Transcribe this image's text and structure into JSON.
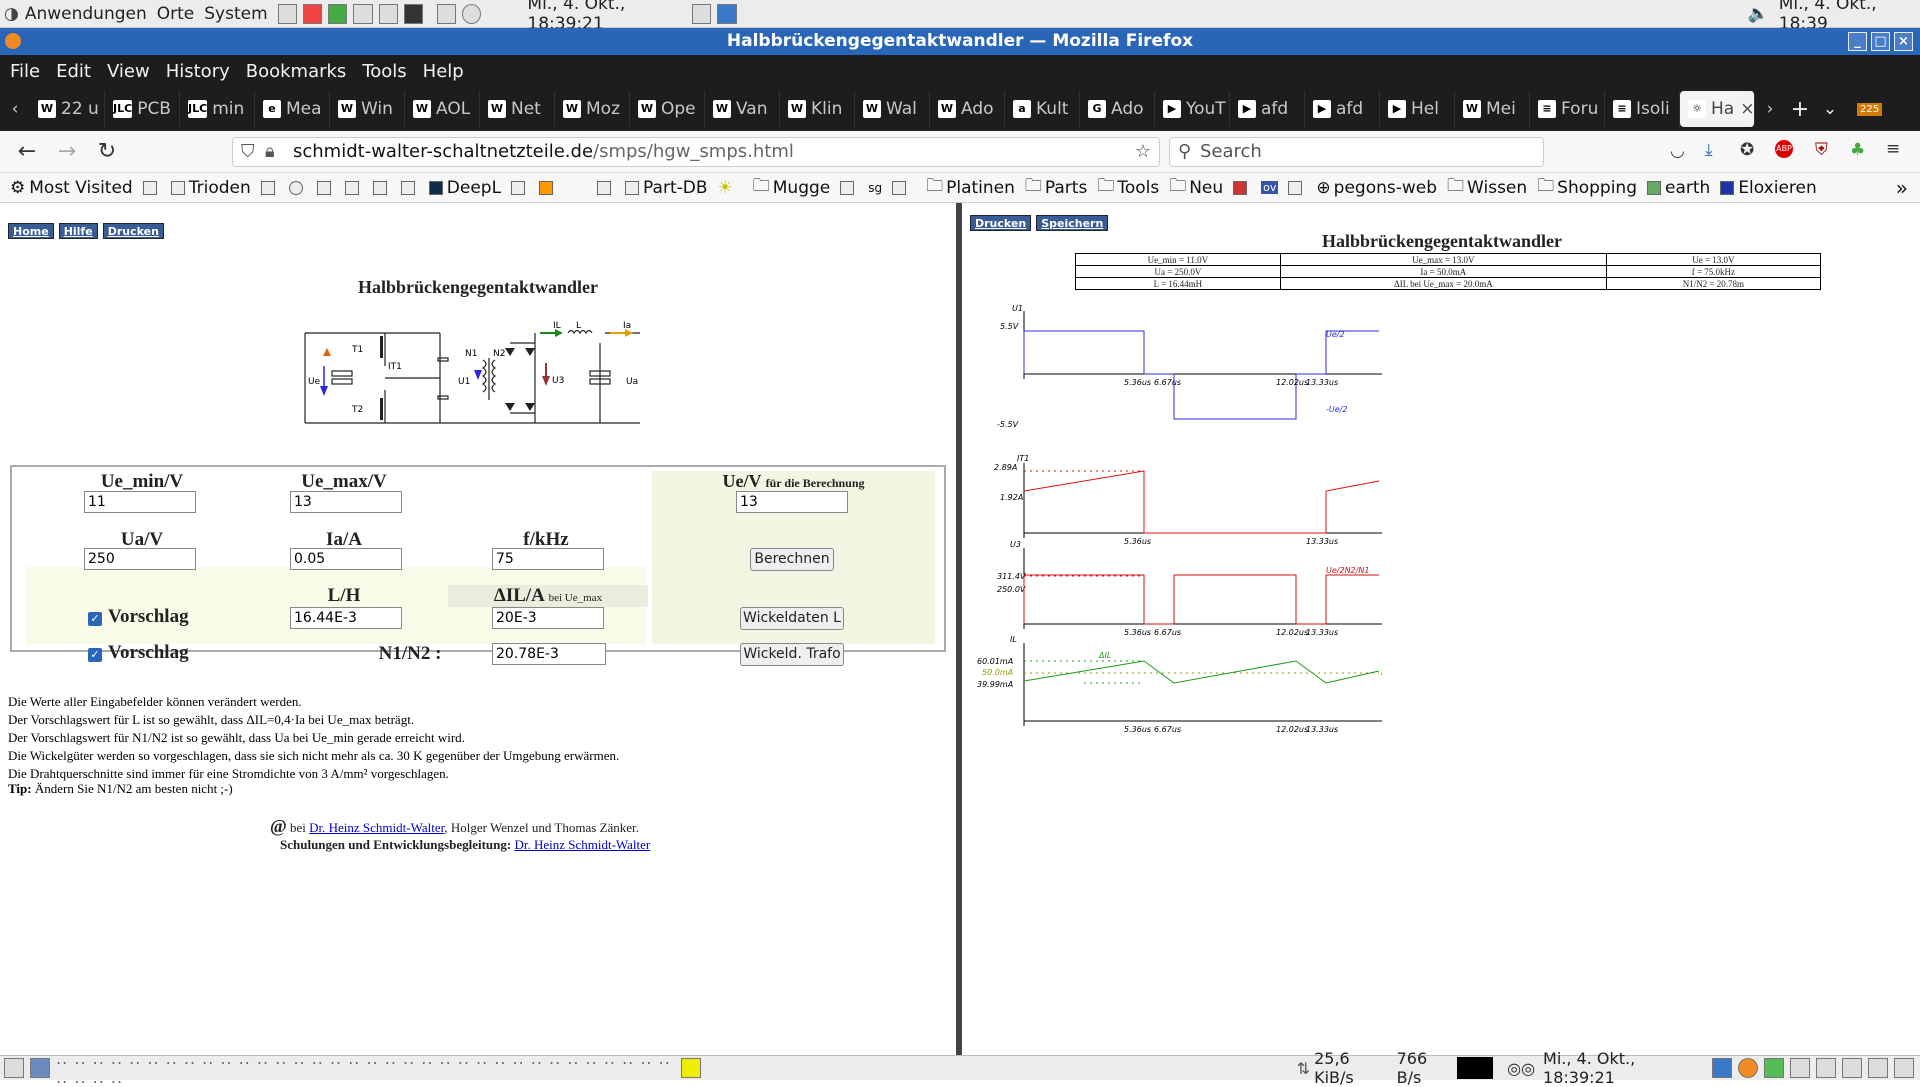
{
  "system_panel": {
    "menus": [
      "Anwendungen",
      "Orte",
      "System"
    ],
    "clock_center": "Mi., 4. Okt., 18:39:21",
    "clock_right": "Mi., 4. Okt., 18:39"
  },
  "window": {
    "title": "Halbbrückengegentaktwandler — Mozilla Firefox"
  },
  "menubar": [
    "File",
    "Edit",
    "View",
    "History",
    "Bookmarks",
    "Tools",
    "Help"
  ],
  "tabs": [
    {
      "icon": "W",
      "label": "22 u"
    },
    {
      "icon": "JLC",
      "label": "PCB"
    },
    {
      "icon": "JLC",
      "label": "min"
    },
    {
      "icon": "e",
      "label": "Mea"
    },
    {
      "icon": "W",
      "label": "Win"
    },
    {
      "icon": "W",
      "label": "AOL"
    },
    {
      "icon": "W",
      "label": "Net"
    },
    {
      "icon": "W",
      "label": "Moz"
    },
    {
      "icon": "W",
      "label": "Ope"
    },
    {
      "icon": "W",
      "label": "Van"
    },
    {
      "icon": "W",
      "label": "Klin"
    },
    {
      "icon": "W",
      "label": "Wal"
    },
    {
      "icon": "W",
      "label": "Ado"
    },
    {
      "icon": "a",
      "label": "Kult"
    },
    {
      "icon": "G",
      "label": "Ado"
    },
    {
      "icon": "▶",
      "label": "YouT"
    },
    {
      "icon": "▶",
      "label": "afd"
    },
    {
      "icon": "▶",
      "label": "afd"
    },
    {
      "icon": "▶",
      "label": "Hel"
    },
    {
      "icon": "W",
      "label": "Mei"
    },
    {
      "icon": "≡",
      "label": "Foru"
    },
    {
      "icon": "≡",
      "label": "Isoli"
    },
    {
      "icon": "☼",
      "label": "Ha",
      "active": true
    }
  ],
  "tabbar_badge": "225",
  "navbar": {
    "url_host": "schmidt-walter-schaltnetzteile.de",
    "url_path": "/smps/hgw_smps.html",
    "search_placeholder": "Search"
  },
  "bookmarks": [
    "Most Visited",
    "Trioden",
    "DeepL",
    "Part-DB",
    "Mugge",
    "sg",
    "Platinen",
    "Parts",
    "Tools",
    "Neu",
    "ov",
    "pegons-web",
    "Wissen",
    "Shopping",
    "earth",
    "Eloxieren"
  ],
  "left": {
    "top_buttons": [
      "Home",
      "Hilfe",
      "Drucken"
    ],
    "page_title": "Halbbrückengegentaktwandler",
    "schematic_labels": {
      "t1": "T1",
      "t2": "T2",
      "it1": "IT1",
      "ue": "Ue",
      "u1": "U1",
      "n1": "N1",
      "n2": "N2",
      "u3": "U3",
      "il": "IL",
      "l": "L",
      "ia": "Ia",
      "ua": "Ua"
    },
    "form": {
      "ue_min_label": "Ue_min/V",
      "ue_max_label": "Ue_max/V",
      "ue_label": "Ue/V",
      "ue_label_suffix": "für die Berechnung",
      "ue_min": "11",
      "ue_max": "13",
      "ue": "13",
      "ua_label": "Ua/V",
      "ia_label": "Ia/A",
      "f_label": "f/kHz",
      "ua": "250",
      "ia": "0.05",
      "f": "75",
      "calc_button": "Berechnen",
      "l_label": "L/H",
      "dil_label": "ΔIL/A",
      "dil_suffix": "bei Ue_max",
      "vorschlag1": "Vorschlag",
      "l_value": "16.44E-3",
      "dil_value": "20E-3",
      "wickel_l_button": "Wickeldaten L",
      "vorschlag2": "Vorschlag",
      "n_label": "N1/N2 :",
      "n_value": "20.78E-3",
      "wickel_trafo_button": "Wickeld. Trafo"
    },
    "notes": [
      "Die Werte aller Eingabefelder können verändert werden.",
      "Der Vorschlagswert für L ist so gewählt, dass ΔIL=0,4·Ia bei Ue_max beträgt.",
      "Der Vorschlagswert für N1/N2 ist so gewählt, dass Ua bei Ue_min gerade erreicht wird.",
      "Die Wickelgüter werden so vorgeschlagen, dass sie sich nicht mehr als ca. 30 K gegenüber der Umgebung erwärmen.",
      "Die Drahtquerschnitte sind immer für eine Stromdichte von 3 A/mm² vorgeschlagen."
    ],
    "tip_label": "Tip:",
    "tip_text": "Ändern Sie N1/N2 am besten nicht ;-)",
    "credit_prefix": "bei",
    "credit_link": "Dr. Heinz Schmidt-Walter",
    "credit_rest": ", Holger Wenzel und Thomas Zänker.",
    "training_label": "Schulungen und Entwicklungsbegleitung:",
    "training_link": "Dr. Heinz Schmidt-Walter"
  },
  "right": {
    "top_buttons": [
      "Drucken",
      "Speichern"
    ],
    "title": "Halbbrückengegentaktwandler",
    "table": [
      [
        "Ue_min = 11.0V",
        "Ue_max = 13.0V",
        "Ue = 13.0V"
      ],
      [
        "Ua = 250.0V",
        "Ia = 50.0mA",
        "f = 75.0kHz"
      ],
      [
        "L = 16.44mH",
        "ΔIL bei Ue_max = 20.0mA",
        "N1/N2 = 20.78m"
      ]
    ],
    "plots": {
      "u1": {
        "name": "U1",
        "top": "5.5V",
        "bottom": "-5.5V",
        "pos_label": "Ue/2",
        "neg_label": "-Ue/2"
      },
      "it1": {
        "name": "IT1",
        "top": "2.89A",
        "mid": "1.92A"
      },
      "u3": {
        "name": "U3",
        "top": "311.4V",
        "mid": "250.0V",
        "label": "Ue/2N2/N1"
      },
      "il": {
        "name": "IL",
        "top": "60.01mA",
        "mid": "50.0mA",
        "bottom": "39.99mA",
        "delta_label": "ΔIL",
        "ia_label": "Ia"
      },
      "ticks": [
        "5.36us",
        "6.67us",
        "12.02us",
        "13.33us"
      ]
    },
    "colors": {
      "u1": "#2b2bdd",
      "it1": "#e01010",
      "u3": "#cc1010",
      "il": "#1a9a1a"
    }
  },
  "statusbar": {
    "net": "25,6 KiB/s",
    "net2": "766 B/s",
    "clock": "Mi., 4. Okt., 18:39:21"
  }
}
